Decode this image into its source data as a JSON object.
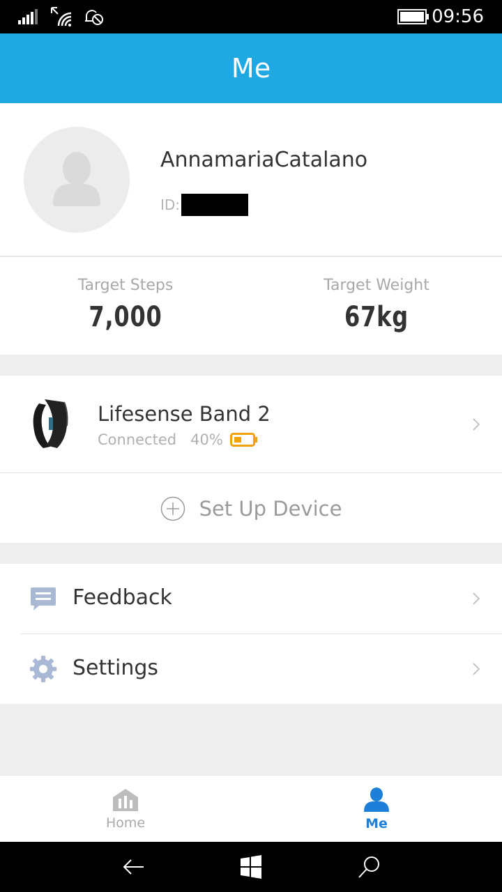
{
  "status_bar": {
    "time": "09:56",
    "icons": [
      "signal-icon",
      "wifi-icon",
      "alarm-off-icon",
      "battery-icon"
    ]
  },
  "app_bar": {
    "title": "Me"
  },
  "profile": {
    "username": "AnnamariaCatalano",
    "id_label": "ID:"
  },
  "targets": {
    "steps_label": "Target Steps",
    "steps_value": "7,000",
    "weight_label": "Target Weight",
    "weight_value": "67kg"
  },
  "device": {
    "name": "Lifesense Band 2",
    "status": "Connected",
    "battery_percent": "40%",
    "battery_level": 0.4,
    "battery_color": "#f0a20a",
    "setup_label": "Set Up Device"
  },
  "menu": {
    "feedback_label": "Feedback",
    "settings_label": "Settings"
  },
  "tabs": {
    "home_label": "Home",
    "me_label": "Me",
    "active": "Me",
    "active_color": "#1e7fd8"
  },
  "colors": {
    "accent": "#1fa8e1"
  }
}
